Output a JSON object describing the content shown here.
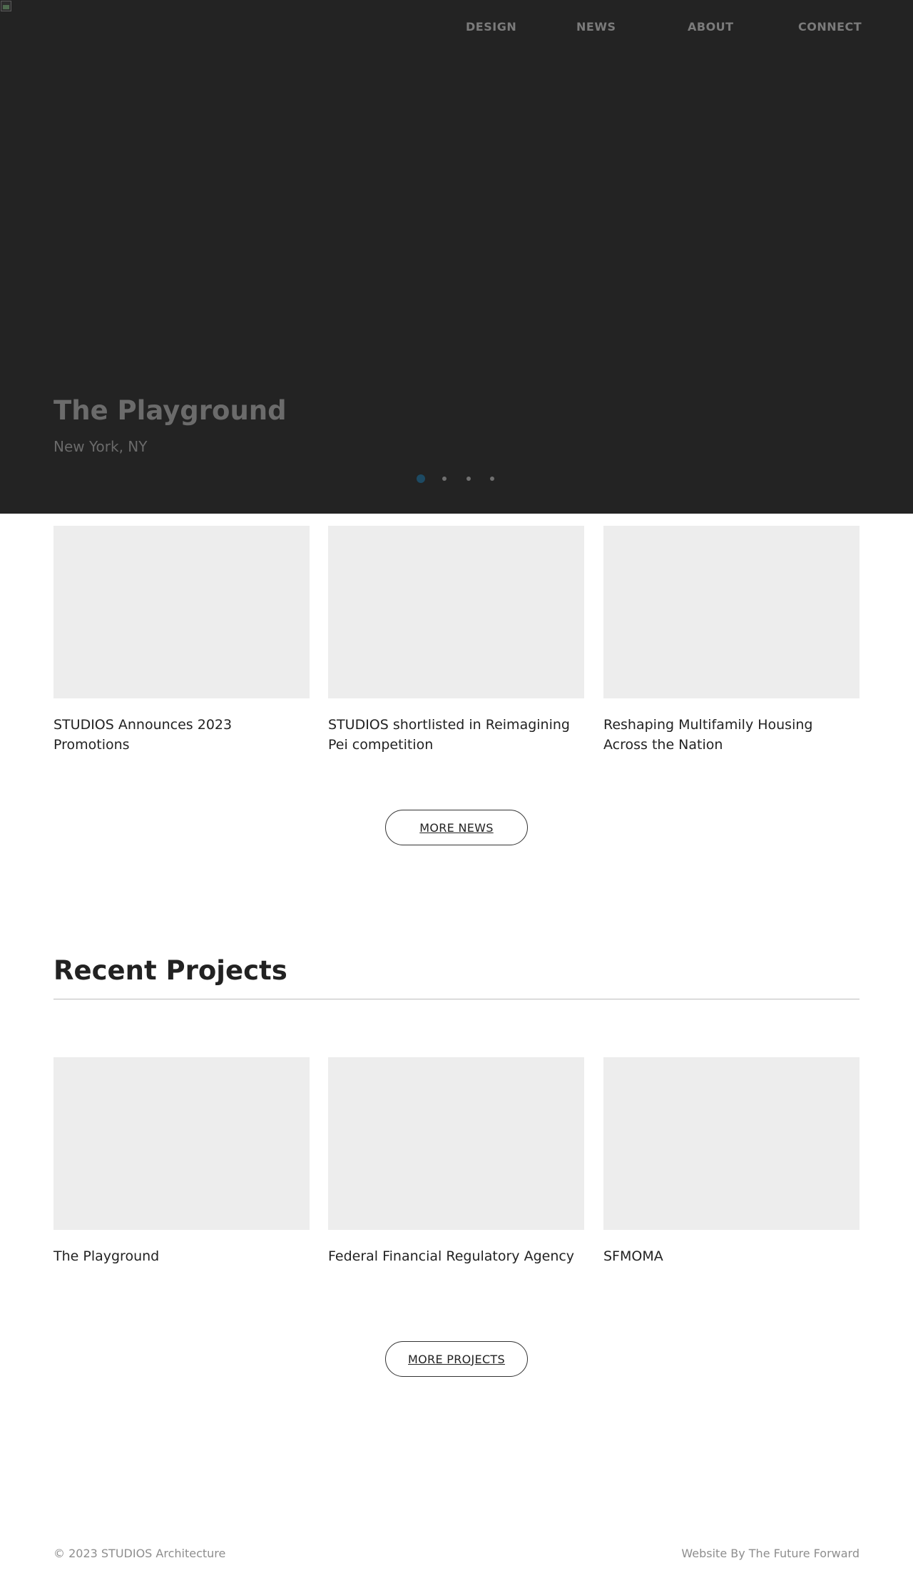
{
  "nav": {
    "items": [
      {
        "label": "DESIGN"
      },
      {
        "label": "NEWS"
      },
      {
        "label": "ABOUT"
      },
      {
        "label": "CONNECT"
      }
    ]
  },
  "hero": {
    "title": "The Playground",
    "subtitle": "New York, NY",
    "slides_total": 4,
    "active_slide": 1
  },
  "news": {
    "cards": [
      {
        "title": "STUDIOS Announces 2023 Promotions"
      },
      {
        "title": "STUDIOS shortlisted in Reimagining Pei competition"
      },
      {
        "title": "Reshaping Multifamily Housing Across the Nation"
      }
    ],
    "more_label": "MORE NEWS"
  },
  "projects": {
    "heading": "Recent Projects",
    "cards": [
      {
        "title": "The Playground"
      },
      {
        "title": "Federal Financial Regulatory Agency"
      },
      {
        "title": "SFMOMA"
      }
    ],
    "more_label": "MORE PROJECTS"
  },
  "footer": {
    "copyright": "© 2023 STUDIOS Architecture",
    "credit": "Website By The Future Forward"
  },
  "colors": {
    "hero_background": "#232323",
    "active_dot": "#1d4a63",
    "thumbnail_placeholder": "#ededed"
  },
  "icons": {
    "hero_image": "broken-image-icon"
  }
}
